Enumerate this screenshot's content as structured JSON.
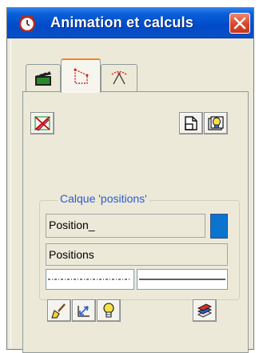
{
  "titlebar": {
    "title": "Animation et calculs",
    "icon": "clock-icon",
    "close_icon": "close-icon"
  },
  "tabs": [
    {
      "icon": "film-clapper-icon",
      "active": false
    },
    {
      "icon": "dotted-corner-shape-icon",
      "active": true
    },
    {
      "icon": "angle-compass-icon",
      "active": false
    }
  ],
  "toolbar": {
    "left_icon": "crossed-edit-icon",
    "right_icons": [
      "new-document-icon",
      "layer-visibility-icon"
    ]
  },
  "layer_group": {
    "label": "Calque 'positions'",
    "name_field": "Position_",
    "type_field": "Positions",
    "color": "#0b74cf",
    "line_styles": [
      "dash-dot-line",
      "solid-line"
    ]
  },
  "bottom_tools": {
    "icons": [
      "paint-brush-icon",
      "move-arrows-icon",
      "light-bulb-icon",
      "layers-stack-icon"
    ]
  },
  "colors": {
    "title_bar": "#0a5fd8",
    "window_bg": "#ece9d8",
    "active_tab_accent": "#e68b2c",
    "group_label": "#2d5bd0",
    "close_button": "#d9452b"
  }
}
